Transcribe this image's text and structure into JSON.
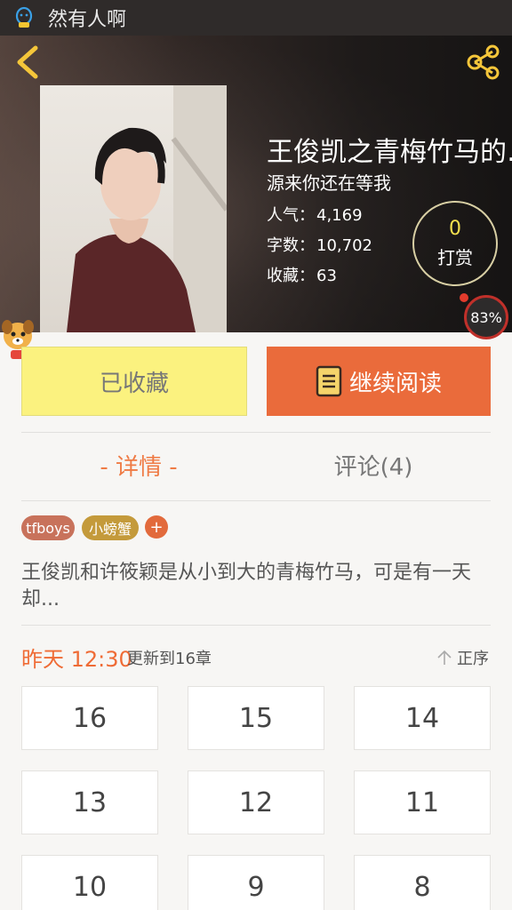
{
  "status_bar": {
    "title": "然有人啊",
    "icon": "qq-icon"
  },
  "book": {
    "title": "王俊凯之青梅竹马的…",
    "author": "源来你还在等我",
    "stats": [
      {
        "key": "人气：",
        "value": "4,169"
      },
      {
        "key": "字数：",
        "value": "10,702"
      },
      {
        "key": "收藏：",
        "value": "63"
      }
    ],
    "reward": {
      "count": "0",
      "label": "打赏"
    },
    "progress": "83%"
  },
  "actions": {
    "favorited_label": "已收藏",
    "read_label": "继续阅读"
  },
  "tabs": [
    {
      "label": "- 详情 -",
      "active": true
    },
    {
      "label": "评论(4)",
      "active": false
    }
  ],
  "tags": [
    "tfboys",
    "小螃蟹"
  ],
  "tag_add": "+",
  "description": "王俊凯和许筱颖是从小到大的青梅竹马，可是有一天却...",
  "update": {
    "time": "昨天 12:30",
    "text": "更新到16章",
    "order_label": "正序"
  },
  "chapters": [
    "16",
    "15",
    "14",
    "13",
    "12",
    "11",
    "10",
    "9",
    "8"
  ],
  "colors": {
    "accent": "#ea6b3b",
    "favorite_bg": "#fbf27f",
    "reward_count": "#f4e04e"
  }
}
